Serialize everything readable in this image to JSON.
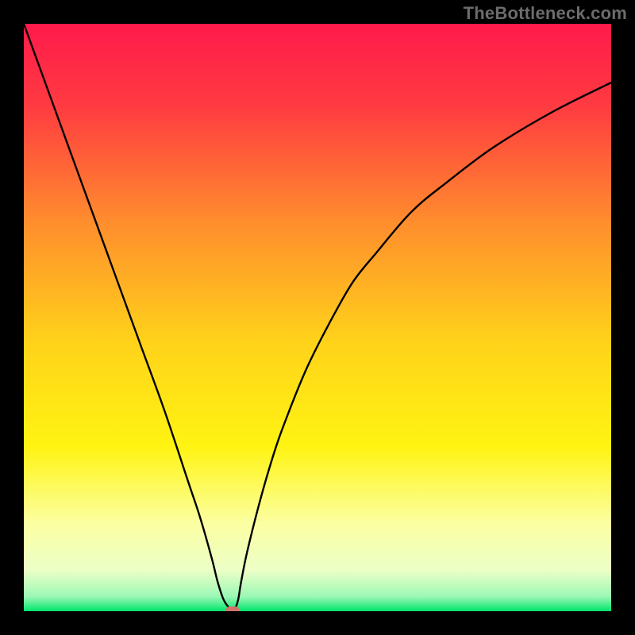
{
  "watermark": "TheBottleneck.com",
  "chart_data": {
    "type": "line",
    "title": "",
    "xlabel": "",
    "ylabel": "",
    "xlim": [
      0,
      100
    ],
    "ylim": [
      0,
      100
    ],
    "grid": false,
    "gradient_stops": [
      {
        "pos": 0.0,
        "color": "#ff1a4b"
      },
      {
        "pos": 0.14,
        "color": "#ff3b41"
      },
      {
        "pos": 0.34,
        "color": "#ff8e2d"
      },
      {
        "pos": 0.54,
        "color": "#ffd21a"
      },
      {
        "pos": 0.72,
        "color": "#fff412"
      },
      {
        "pos": 0.85,
        "color": "#fcffa2"
      },
      {
        "pos": 0.93,
        "color": "#ecffc6"
      },
      {
        "pos": 0.975,
        "color": "#9cf8b5"
      },
      {
        "pos": 1.0,
        "color": "#00e56b"
      }
    ],
    "series": [
      {
        "name": "bottleneck-curve",
        "color": "#000000",
        "x": [
          0,
          4,
          8,
          12,
          16,
          20,
          24,
          28,
          30,
          32,
          33,
          34,
          35,
          35.5,
          36,
          36.5,
          37,
          38,
          40,
          42,
          44,
          48,
          52,
          56,
          60,
          66,
          72,
          80,
          90,
          100
        ],
        "y": [
          100,
          89,
          78,
          67,
          56,
          45,
          34,
          22,
          16,
          9,
          5,
          2,
          0.5,
          0,
          0.5,
          2,
          5,
          10,
          18,
          25,
          31,
          41,
          49,
          56,
          61,
          68,
          73,
          79,
          85,
          90
        ]
      }
    ],
    "marker": {
      "name": "optimum-point",
      "x": 35.5,
      "y": 0,
      "color": "#d1736b"
    }
  }
}
